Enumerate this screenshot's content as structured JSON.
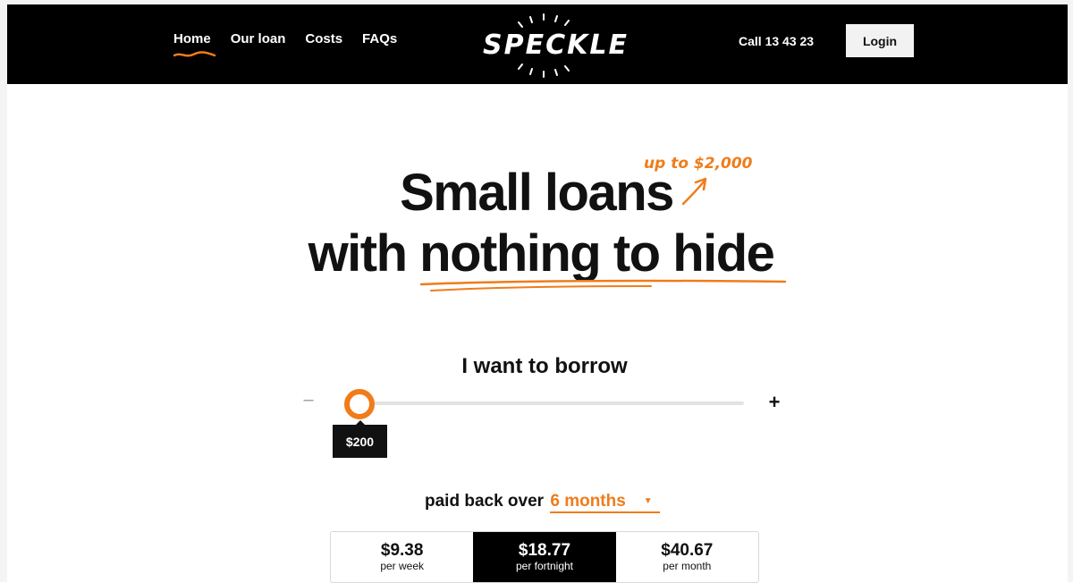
{
  "nav": {
    "items": [
      {
        "label": "Home",
        "active": true
      },
      {
        "label": "Our loan",
        "active": false
      },
      {
        "label": "Costs",
        "active": false
      },
      {
        "label": "FAQs",
        "active": false
      }
    ],
    "brand": "SPECKLE",
    "phone": "Call 13 43 23",
    "login_label": "Login"
  },
  "hero": {
    "tagline": "up to $2,000",
    "line1": "Small loans",
    "line2_prefix": "with ",
    "line2_emphasis": "nothing to hide"
  },
  "borrow": {
    "title": "I want to borrow",
    "minus_label": "–",
    "plus_label": "+",
    "amount": "$200",
    "slider_fraction": 0.0
  },
  "term": {
    "prefix": "paid back over ",
    "selected": "6 months",
    "caret": "▼"
  },
  "repayments": [
    {
      "amount": "$9.38",
      "period": "per week",
      "selected": false
    },
    {
      "amount": "$18.77",
      "period": "per fortnight",
      "selected": true
    },
    {
      "amount": "$40.67",
      "period": "per month",
      "selected": false
    }
  ],
  "colors": {
    "accent": "#f07c1a",
    "header_bg": "#000000",
    "text": "#111111"
  },
  "icons": {
    "brand_rays": "sun-rays-icon",
    "tagline_arrow": "arrow-up-right-icon",
    "underline": "scribble-underline-icon"
  }
}
